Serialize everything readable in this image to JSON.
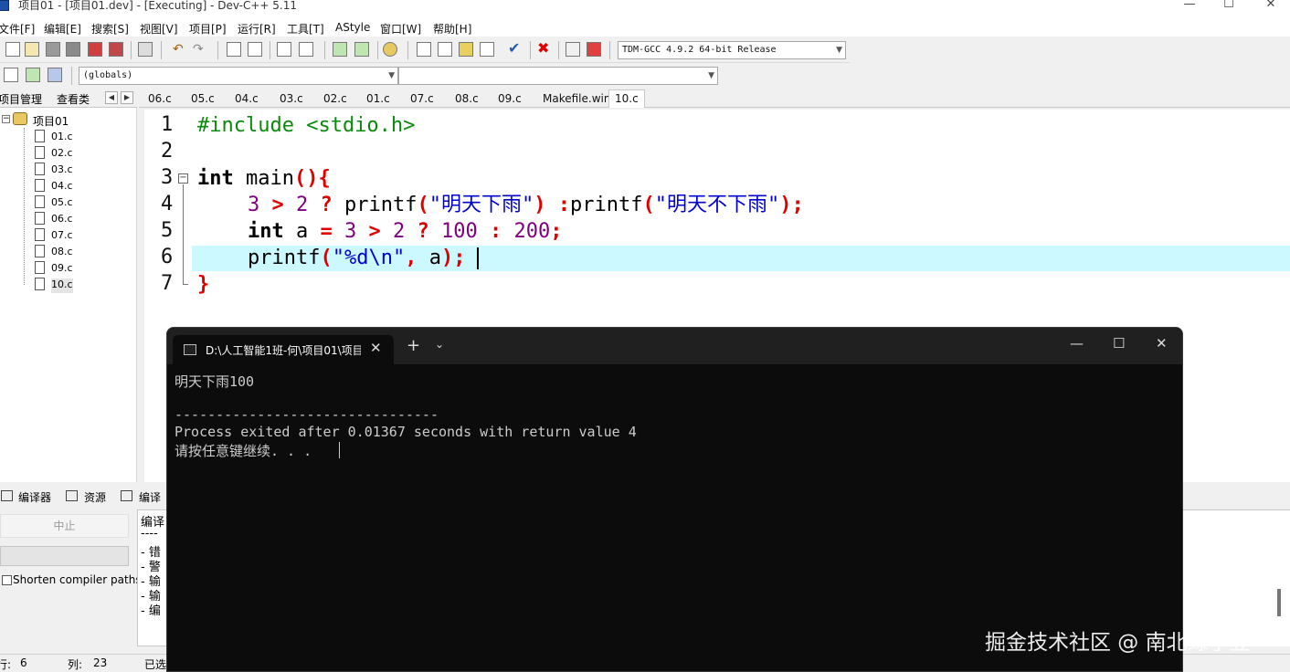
{
  "window": {
    "title": "项目01 - [项目01.dev] - [Executing] - Dev-C++ 5.11",
    "minimize": "—",
    "maximize": "☐",
    "close": "✕"
  },
  "menu": [
    "文件[F]",
    "编辑[E]",
    "搜索[S]",
    "视图[V]",
    "项目[P]",
    "运行[R]",
    "工具[T]",
    "AStyle",
    "窗口[W]",
    "帮助[H]"
  ],
  "toolbar": {
    "compiler": "TDM-GCC 4.9.2 64-bit Release",
    "scope": "(globals)"
  },
  "left_panel": {
    "tabs": [
      "项目管理",
      "查看类"
    ],
    "arrows": [
      "◀",
      "▶"
    ],
    "project": "项目01",
    "files": [
      "01.c",
      "02.c",
      "03.c",
      "04.c",
      "05.c",
      "06.c",
      "07.c",
      "08.c",
      "09.c",
      "10.c"
    ]
  },
  "editor": {
    "tabs": [
      "06.c",
      "05.c",
      "04.c",
      "03.c",
      "02.c",
      "01.c",
      "07.c",
      "08.c",
      "09.c",
      "Makefile.win",
      "10.c"
    ],
    "active_tab": "10.c",
    "line_numbers": [
      "1",
      "2",
      "3",
      "4",
      "5",
      "6",
      "7"
    ],
    "fold_marker": "−",
    "code": {
      "l1": "#include <stdio.h>",
      "l3_kw": "int",
      "l3_id": " main",
      "l3_punct": "(){",
      "l4_num1": "3",
      "l4_op1": " > ",
      "l4_num2": "2",
      "l4_op2": " ? ",
      "l4_fn1": "printf",
      "l4_p1": "(",
      "l4_s1": "\"明天下雨\"",
      "l4_p2": ")",
      "l4_op3": " :",
      "l4_fn2": "printf",
      "l4_p3": "(",
      "l4_s2": "\"明天不下雨\"",
      "l4_p4": ");",
      "l5_kw": "int",
      "l5_id": " a ",
      "l5_eq": "=",
      "l5_num1": " 3",
      "l5_op1": " > ",
      "l5_num2": "2",
      "l5_op2": " ? ",
      "l5_num3": "100",
      "l5_op3": " : ",
      "l5_num4": "200",
      "l5_semi": ";",
      "l6_fn": "printf",
      "l6_p1": "(",
      "l6_s": "\"%d\\n\"",
      "l6_comma": ",",
      "l6_id": " a",
      "l6_p2": ");",
      "l7": "}"
    }
  },
  "bottom": {
    "tabs": [
      "编译器",
      "资源",
      "编译"
    ],
    "abort": "中止",
    "shorten_paths": "Shorten compiler paths",
    "log_lines": [
      "编译",
      "----",
      "- 错",
      "- 警",
      "- 输",
      "- 输",
      "- 编"
    ]
  },
  "status": {
    "row_label": "行:",
    "row": "6",
    "col_label": "列:",
    "col": "23",
    "state": "已选"
  },
  "terminal": {
    "tab_title": "D:\\人工智能1班-何\\项目01\\项目",
    "plus": "+",
    "chevron": "⌄",
    "close_tab": "✕",
    "min": "—",
    "max": "☐",
    "close": "✕",
    "output": "明天下雨100",
    "separator": "--------------------------------",
    "exit_msg": "Process exited after 0.01367 seconds with return value 4",
    "prompt": "请按任意键继续. . ."
  },
  "watermark": "掘金技术社区 @ 南北绿了豆"
}
